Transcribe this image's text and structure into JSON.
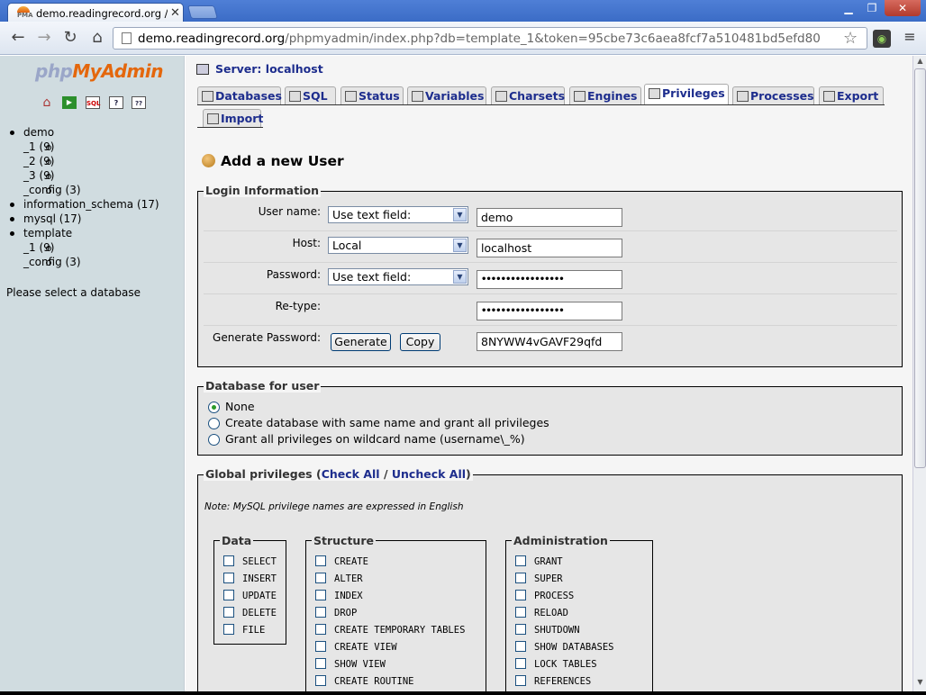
{
  "browser": {
    "tab_title": "demo.readingrecord.org / loc",
    "favicon_text": "PMA",
    "url_host": "demo.readingrecord.org",
    "url_path": "/phpmyadmin/index.php?db=template_1&token=95cbe73c6aea8fcf7a510481bd5efd80"
  },
  "sidebar": {
    "logo": {
      "php": "php",
      "my": "My",
      "admin": "Admin"
    },
    "icons": [
      "home-icon",
      "exit-icon",
      "sql-icon",
      "query-window-icon",
      "docs-icon"
    ],
    "databases": [
      {
        "label": "demo",
        "children": [
          "_1 (9)",
          "_2 (9)",
          "_3 (9)",
          "_config (3)"
        ]
      },
      {
        "label": "information_schema (17)",
        "children": []
      },
      {
        "label": "mysql (17)",
        "children": []
      },
      {
        "label": "template",
        "children": [
          "_1 (9)",
          "_config (3)"
        ]
      }
    ],
    "hint": "Please select a database"
  },
  "server": {
    "title": "Server: localhost"
  },
  "tabs": [
    {
      "label": "Databases"
    },
    {
      "label": "SQL"
    },
    {
      "label": "Status"
    },
    {
      "label": "Variables"
    },
    {
      "label": "Charsets"
    },
    {
      "label": "Engines"
    },
    {
      "label": "Privileges",
      "active": true
    },
    {
      "label": "Processes"
    },
    {
      "label": "Export"
    },
    {
      "label": "Import"
    }
  ],
  "page_title": "Add a new User",
  "login": {
    "legend": "Login Information",
    "user_label": "User name:",
    "user_mode": "Use text field:",
    "user_value": "demo",
    "host_label": "Host:",
    "host_mode": "Local",
    "host_value": "localhost",
    "password_label": "Password:",
    "password_mode": "Use text field:",
    "password_value": "•••••••••••••••••",
    "retype_label": "Re-type:",
    "retype_value": "•••••••••••••••••",
    "generate_label": "Generate Password:",
    "generate_button": "Generate",
    "copy_button": "Copy",
    "generated_value": "8NYWW4vGAVF29qfd"
  },
  "database_for_user": {
    "legend": "Database for user",
    "options": [
      {
        "label": "None",
        "checked": true
      },
      {
        "label": "Create database with same name and grant all privileges",
        "checked": false
      },
      {
        "label": "Grant all privileges on wildcard name (username\\_%)",
        "checked": false
      }
    ]
  },
  "global_privileges": {
    "legend": "Global privileges",
    "open": "(",
    "check_all": "Check All",
    "separator": "/",
    "uncheck_all": "Uncheck All",
    "close": ")",
    "note": "Note: MySQL privilege names are expressed in English",
    "groups": {
      "data": {
        "legend": "Data",
        "items": [
          "SELECT",
          "INSERT",
          "UPDATE",
          "DELETE",
          "FILE"
        ]
      },
      "structure": {
        "legend": "Structure",
        "items": [
          "CREATE",
          "ALTER",
          "INDEX",
          "DROP",
          "CREATE TEMPORARY TABLES",
          "CREATE VIEW",
          "SHOW VIEW",
          "CREATE ROUTINE"
        ]
      },
      "administration": {
        "legend": "Administration",
        "items": [
          "GRANT",
          "SUPER",
          "PROCESS",
          "RELOAD",
          "SHUTDOWN",
          "SHOW DATABASES",
          "LOCK TABLES",
          "REFERENCES"
        ]
      }
    }
  }
}
